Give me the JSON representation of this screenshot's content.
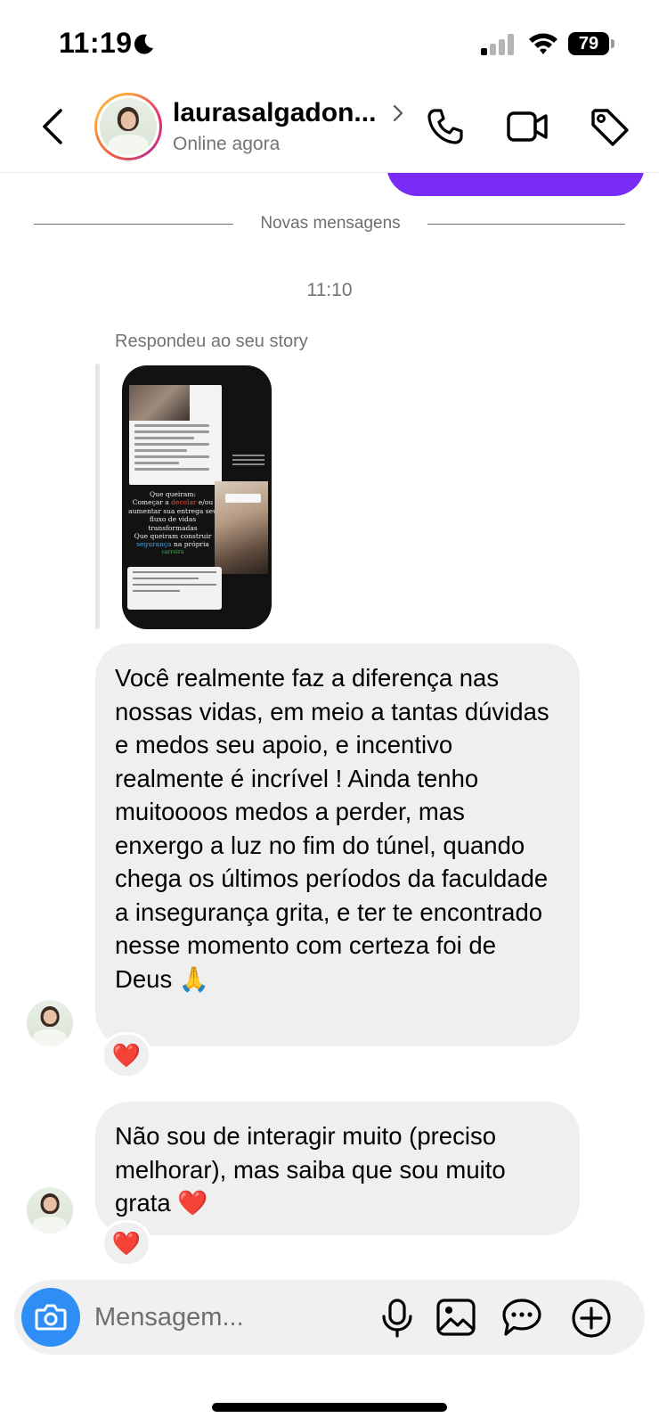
{
  "status_bar": {
    "time": "11:19",
    "battery": "79"
  },
  "header": {
    "contact_name": "laurasalgadon...",
    "status": "Online agora"
  },
  "thread": {
    "divider_label": "Novas mensagens",
    "time": "11:10",
    "story_caption": "Respondeu ao seu story",
    "story_thumbnail": {
      "text_line1": "Que queiram:",
      "text_line2_a": "Começar a ",
      "text_line2_b": "decolar",
      "text_line2_c": " e/ou",
      "text_line3": "aumentar sua entrega seu",
      "text_line4": "fluxo de vidas",
      "text_line5": "transformadas",
      "text_line6": "Que queiram construir",
      "text_line7_a": "segurança",
      "text_line7_b": " na própria",
      "text_line8": "carreira"
    },
    "messages": [
      {
        "text": "Você realmente faz a diferença nas nossas vidas, em meio a tantas dúvidas e medos seu apoio, e incentivo realmente é incrível ! Ainda tenho muitoooos medos a perder, mas enxergo a luz no fim do túnel, quando chega os últimos períodos da faculdade a insegurança grita, e ter te encontrado nesse momento com certeza foi de Deus 🙏",
        "reaction": "❤️"
      },
      {
        "text": "Não sou de interagir muito (preciso melhorar), mas saiba que sou muito grata ❤️",
        "reaction": "❤️"
      }
    ]
  },
  "composer": {
    "placeholder": "Mensagem..."
  },
  "colors": {
    "accent": "#7a2cf7",
    "camera_button": "#2f8ef5",
    "bubble_bg": "#efefef",
    "heart": "#e0242f"
  },
  "icons": [
    "moon-icon",
    "signal-icon",
    "wifi-icon",
    "battery-icon",
    "back-icon",
    "chevron-right-icon",
    "phone-icon",
    "video-camera-icon",
    "tag-icon",
    "camera-icon",
    "microphone-icon",
    "gallery-icon",
    "sticker-icon",
    "plus-icon"
  ]
}
